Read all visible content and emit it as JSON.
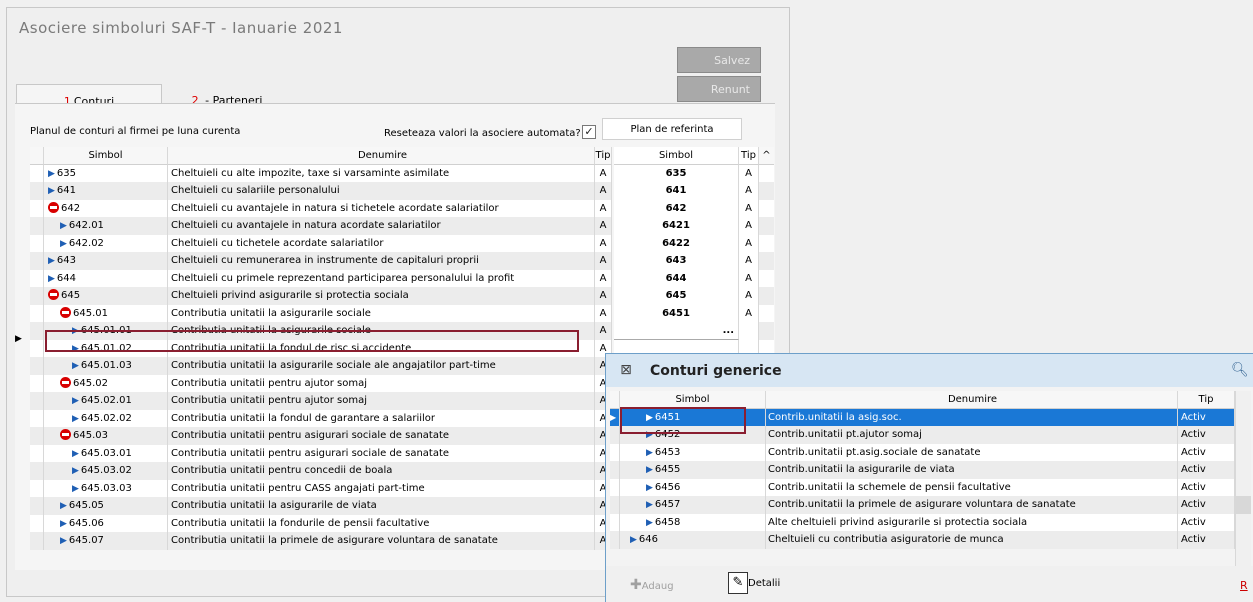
{
  "window": {
    "title": "Asociere simboluri SAF-T - Ianuarie 2021",
    "save_label": "Salvez",
    "cancel_label": "Renunt"
  },
  "tabs": [
    {
      "num": "1",
      "label": "Conturi"
    },
    {
      "num": "2",
      "label": " - Parteneri"
    }
  ],
  "options": {
    "plan_label": "Planul de conturi al firmei pe luna curenta",
    "reset_label": "Reseteaza valori la asociere automata?",
    "reset_checked": "✓",
    "ref_plan_label": "Plan de referinta"
  },
  "grid": {
    "headers": {
      "simbol": "Simbol",
      "denumire": "Denumire",
      "tip": "Tip",
      "ref_simbol": "Simbol",
      "ref_tip": "Tip"
    },
    "rows": [
      {
        "icon": "play",
        "indent": 0,
        "simbol": "635",
        "denumire": "Cheltuieli cu alte impozite, taxe si varsaminte asimilate",
        "tip": "A",
        "ref": "635",
        "ref_tip": "A"
      },
      {
        "icon": "play",
        "indent": 0,
        "simbol": "641",
        "denumire": "Cheltuieli cu salariile personalului",
        "tip": "A",
        "ref": "641",
        "ref_tip": "A"
      },
      {
        "icon": "minus",
        "indent": 0,
        "simbol": "642",
        "denumire": "Cheltuieli cu avantajele in natura si tichetele acordate salariatilor",
        "tip": "A",
        "ref": "642",
        "ref_tip": "A"
      },
      {
        "icon": "play",
        "indent": 1,
        "simbol": "642.01",
        "denumire": "Cheltuieli cu avantajele in natura acordate salariatilor",
        "tip": "A",
        "ref": "6421",
        "ref_tip": "A"
      },
      {
        "icon": "play",
        "indent": 1,
        "simbol": "642.02",
        "denumire": "Cheltuieli cu tichetele acordate salariatilor",
        "tip": "A",
        "ref": "6422",
        "ref_tip": "A"
      },
      {
        "icon": "play",
        "indent": 0,
        "simbol": "643",
        "denumire": "Cheltuieli cu remunerarea in instrumente de capitaluri proprii",
        "tip": "A",
        "ref": "643",
        "ref_tip": "A"
      },
      {
        "icon": "play",
        "indent": 0,
        "simbol": "644",
        "denumire": "Cheltuieli cu primele reprezentand participarea personalului la profit",
        "tip": "A",
        "ref": "644",
        "ref_tip": "A"
      },
      {
        "icon": "minus",
        "indent": 0,
        "simbol": "645",
        "denumire": "Cheltuieli privind asigurarile si protectia sociala",
        "tip": "A",
        "ref": "645",
        "ref_tip": "A"
      },
      {
        "icon": "minus",
        "indent": 1,
        "simbol": "645.01",
        "denumire": "Contributia unitatii la asigurarile sociale",
        "tip": "A",
        "ref": "6451",
        "ref_tip": "A"
      },
      {
        "icon": "play",
        "indent": 2,
        "simbol": "645.01.01",
        "denumire": "Contributia unitatii la asigurarile sociale",
        "tip": "A",
        "ref": "...",
        "ref_tip": ""
      },
      {
        "icon": "play",
        "indent": 2,
        "simbol": "645.01.02",
        "denumire": "Contributia unitatii la fondul de risc si accidente",
        "tip": "A",
        "ref": "",
        "ref_tip": ""
      },
      {
        "icon": "play",
        "indent": 2,
        "simbol": "645.01.03",
        "denumire": "Contributia unitatii la asigurarile sociale ale angajatilor part-time",
        "tip": "A",
        "ref": "",
        "ref_tip": ""
      },
      {
        "icon": "minus",
        "indent": 1,
        "simbol": "645.02",
        "denumire": "Contributia unitatii pentru ajutor somaj",
        "tip": "A",
        "ref": "",
        "ref_tip": ""
      },
      {
        "icon": "play",
        "indent": 2,
        "simbol": "645.02.01",
        "denumire": "Contributia unitatii pentru ajutor somaj",
        "tip": "A",
        "ref": "",
        "ref_tip": ""
      },
      {
        "icon": "play",
        "indent": 2,
        "simbol": "645.02.02",
        "denumire": "Contributia unitatii la fondul de garantare a salariilor",
        "tip": "A",
        "ref": "",
        "ref_tip": ""
      },
      {
        "icon": "minus",
        "indent": 1,
        "simbol": "645.03",
        "denumire": "Contributia unitatii pentru asigurari sociale de sanatate",
        "tip": "A",
        "ref": "",
        "ref_tip": ""
      },
      {
        "icon": "play",
        "indent": 2,
        "simbol": "645.03.01",
        "denumire": "Contributia unitatii pentru asigurari sociale de sanatate",
        "tip": "A",
        "ref": "",
        "ref_tip": ""
      },
      {
        "icon": "play",
        "indent": 2,
        "simbol": "645.03.02",
        "denumire": "Contributia unitatii pentru concedii de boala",
        "tip": "A",
        "ref": "",
        "ref_tip": ""
      },
      {
        "icon": "play",
        "indent": 2,
        "simbol": "645.03.03",
        "denumire": "Contributia unitatii pentru CASS angajati part-time",
        "tip": "A",
        "ref": "",
        "ref_tip": ""
      },
      {
        "icon": "play",
        "indent": 1,
        "simbol": "645.05",
        "denumire": "Contributia unitatii la asigurarile de viata",
        "tip": "A",
        "ref": "",
        "ref_tip": ""
      },
      {
        "icon": "play",
        "indent": 1,
        "simbol": "645.06",
        "denumire": "Contributia unitatii la fondurile de pensii facultative",
        "tip": "A",
        "ref": "",
        "ref_tip": ""
      },
      {
        "icon": "play",
        "indent": 1,
        "simbol": "645.07",
        "denumire": "Contributia unitatii la primele de asigurare voluntara de sanatate",
        "tip": "A",
        "ref": "",
        "ref_tip": ""
      }
    ]
  },
  "popup": {
    "title": "Conturi generice",
    "headers": {
      "simbol": "Simbol",
      "denumire": "Denumire",
      "tip": "Tip"
    },
    "rows": [
      {
        "simbol": "6451",
        "denumire": "Contrib.unitatii la asig.soc.",
        "tip": "Activ",
        "selected": true,
        "indent": 1
      },
      {
        "simbol": "6452",
        "denumire": "Contrib.unitatii pt.ajutor somaj",
        "tip": "Activ",
        "selected": false,
        "indent": 1
      },
      {
        "simbol": "6453",
        "denumire": "Contrib.unitatii pt.asig.sociale de sanatate",
        "tip": "Activ",
        "selected": false,
        "indent": 1
      },
      {
        "simbol": "6455",
        "denumire": "Contrib.unitatii la asigurarile de viata",
        "tip": "Activ",
        "selected": false,
        "indent": 1
      },
      {
        "simbol": "6456",
        "denumire": "Contrib.unitatii la schemele de pensii facultative",
        "tip": "Activ",
        "selected": false,
        "indent": 1
      },
      {
        "simbol": "6457",
        "denumire": "Contrib.unitatii la primele de asigurare voluntara de sanatate",
        "tip": "Activ",
        "selected": false,
        "indent": 1
      },
      {
        "simbol": "6458",
        "denumire": "Alte cheltuieli privind asigurarile si protectia sociala",
        "tip": "Activ",
        "selected": false,
        "indent": 1
      },
      {
        "simbol": "646",
        "denumire": "Cheltuieli cu contributia asiguratorie de munca",
        "tip": "Activ",
        "selected": false,
        "indent": 0
      }
    ],
    "add_label": "Adaug",
    "details_label": "Detalii",
    "corner_label": "R"
  },
  "colors": {
    "selection_frame": "#8a1e30",
    "selected_row": "#1a78d6",
    "play_icon": "#1f5fb4",
    "minus_icon": "#d80000",
    "tab_number": "#dd0000"
  }
}
